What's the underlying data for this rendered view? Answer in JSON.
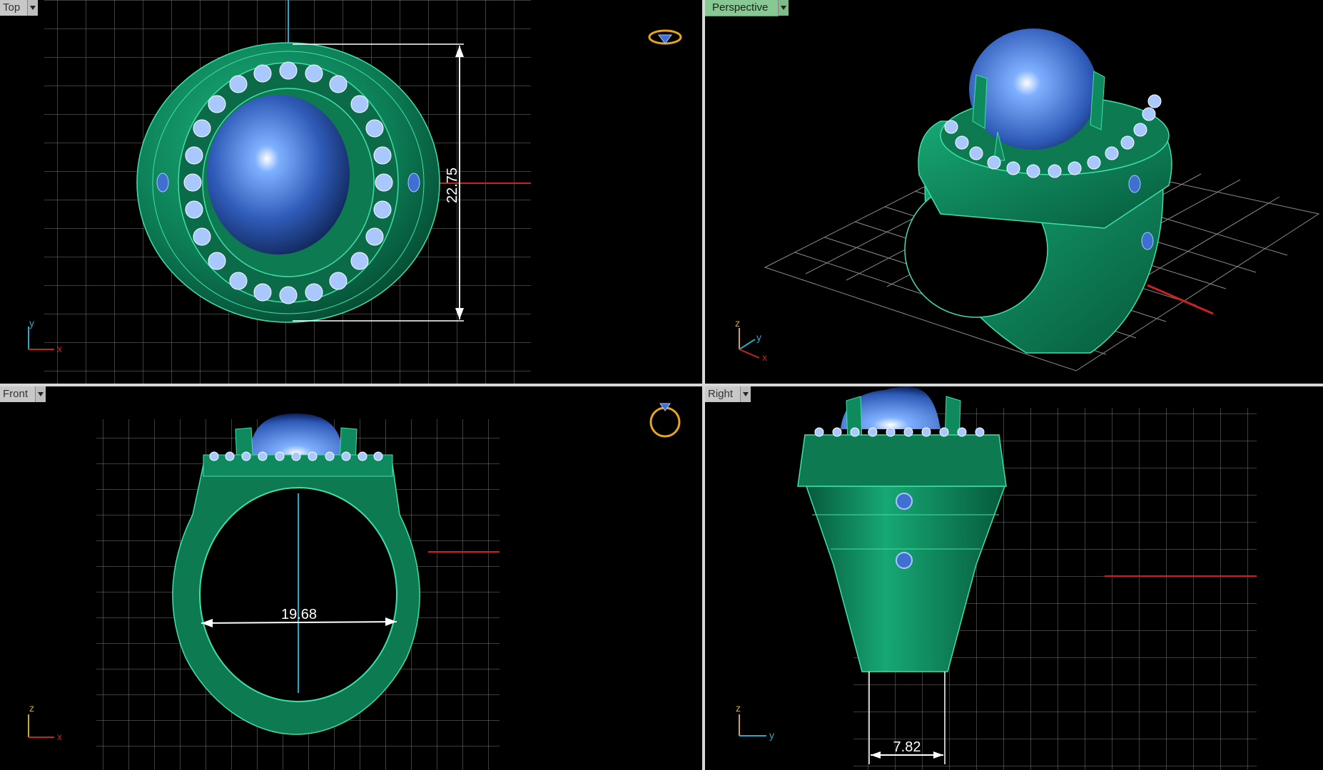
{
  "viewports": {
    "top": {
      "label": "Top",
      "dimension": "22.75",
      "axes": [
        "y",
        "x"
      ]
    },
    "perspective": {
      "label": "Perspective",
      "axes": [
        "z",
        "y",
        "x"
      ]
    },
    "front": {
      "label": "Front",
      "dimension": "19.68",
      "axes": [
        "z",
        "x"
      ]
    },
    "right": {
      "label": "Right",
      "dimension": "7.82",
      "axes": [
        "z",
        "y"
      ]
    }
  },
  "icons": {
    "top_view_icon": "ring-top-view-icon",
    "front_view_icon": "ring-front-view-icon",
    "dropdown": "chevron-down-icon"
  },
  "colors": {
    "ring_metal": "#0f8a5f",
    "wireframe": "#3fe0a8",
    "gem": "#3e6fd1",
    "small_stone": "#a9c8ff",
    "grid": "#9a9a9a",
    "axis_x": "#cc1f1f",
    "axis_y": "#2aa8c8",
    "axis_z": "#d4a82a",
    "active_tab": "#88c894"
  }
}
